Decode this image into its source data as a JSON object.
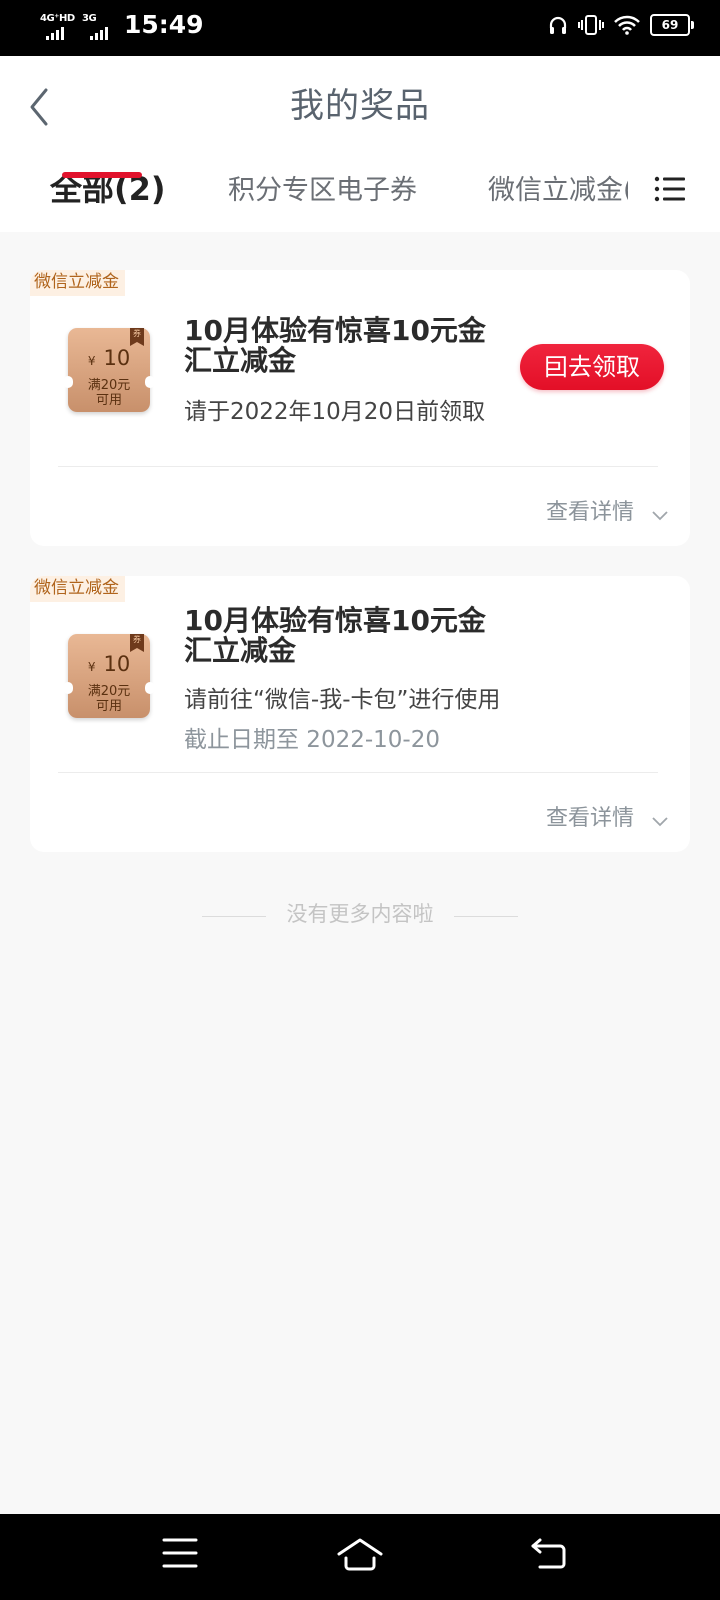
{
  "status_bar": {
    "network_1": "4G⁺HD",
    "network_2": "3G",
    "time": "15:49",
    "battery": "69",
    "icons": [
      "headphones-icon",
      "vibrate-icon",
      "wifi-icon",
      "battery-icon"
    ]
  },
  "header": {
    "title": "我的奖品",
    "back_icon": "chevron-left-icon",
    "menu_icon": "list-menu-icon"
  },
  "tabs": [
    {
      "label": "全部(2)",
      "active": true
    },
    {
      "label": "积分专区电子券",
      "active": false
    },
    {
      "label": "微信立减金(",
      "active": false
    }
  ],
  "accent_color": "#e1122c",
  "cards": [
    {
      "tag": "微信立减金",
      "coupon": {
        "currency": "¥",
        "amount": "10",
        "condition_line1": "满20元",
        "condition_line2": "可用",
        "ribbon": "券"
      },
      "title": "10月体验有惊喜10元金汇立减金",
      "subtitle": "请于2022年10月20日前领取",
      "action": "囙去领取",
      "detail": "查看详情"
    },
    {
      "tag": "微信立减金",
      "coupon": {
        "currency": "¥",
        "amount": "10",
        "condition_line1": "满20元",
        "condition_line2": "可用",
        "ribbon": "券"
      },
      "title": "10月体验有惊喜10元金汇立减金",
      "subtitle": "请前往“微信-我-卡包”进行使用",
      "date": "截止日期至 2022-10-20",
      "detail": "查看详情"
    }
  ],
  "end_note": "没有更多内容啦",
  "nav_bar": {
    "icons": [
      "menu-icon",
      "home-icon",
      "back-icon"
    ]
  }
}
